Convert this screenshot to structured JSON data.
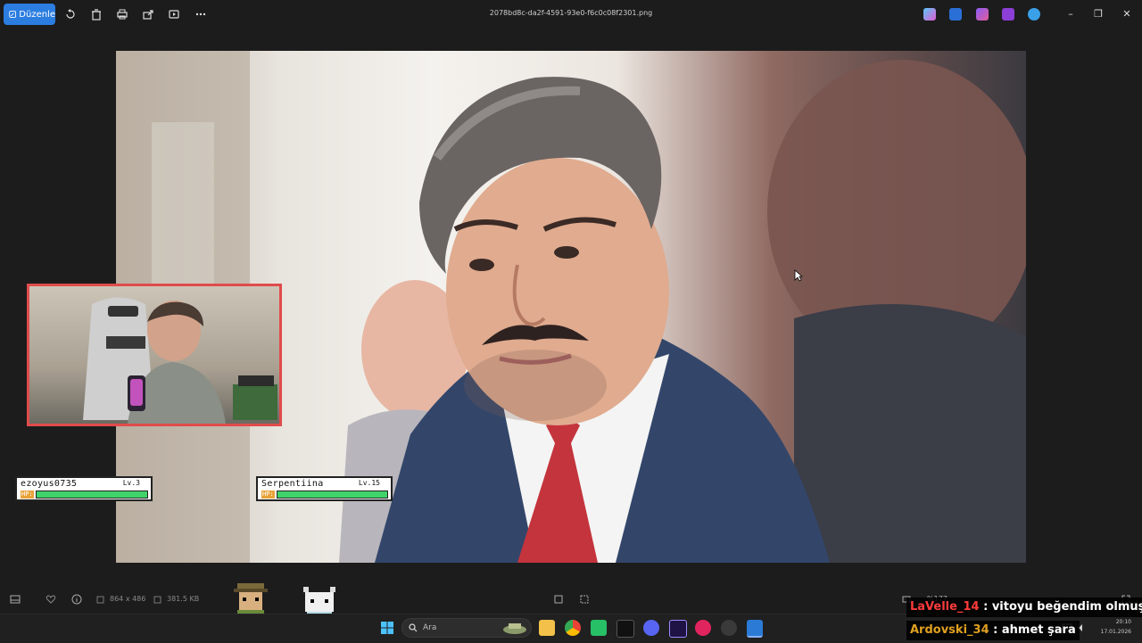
{
  "toolbar": {
    "edit_label": "Düzenle",
    "icons": [
      "rotate-icon",
      "delete-icon",
      "print-icon",
      "share-icon",
      "slideshow-icon",
      "more-icon"
    ]
  },
  "window": {
    "title": "2078bd8c-da2f-4591-93e0-f6c0c08f2301.png",
    "controls": [
      "minimize",
      "restore",
      "close"
    ]
  },
  "overlay": {
    "player1": {
      "name": "ezoyus0735",
      "level": "Lv.3",
      "hp_label": "HP:",
      "hp_fraction": 1.0
    },
    "player2": {
      "name": "Serpentiina",
      "level": "Lv.15",
      "hp_label": "HP:",
      "hp_fraction": 1.0
    }
  },
  "status": {
    "dimensions": "864 x 486",
    "file_size": "381.5 KB",
    "zoom": "%177"
  },
  "taskbar": {
    "search_placeholder": "Ara",
    "time": "20:10",
    "date": "17.01.2026"
  },
  "chat": [
    {
      "user": "LaVelle_14",
      "separator": " : ",
      "message": "vitoyu beğendim olmuş"
    },
    {
      "user": "Ardovski_34",
      "separator": " : ",
      "message": "ahmet şara"
    }
  ],
  "colors": {
    "accent": "#2b7de0",
    "webcam_border": "#e04b4b",
    "hp_green": "#3fd36a",
    "chat_user1": "#ff3b3b",
    "chat_user2": "#e0a020"
  }
}
